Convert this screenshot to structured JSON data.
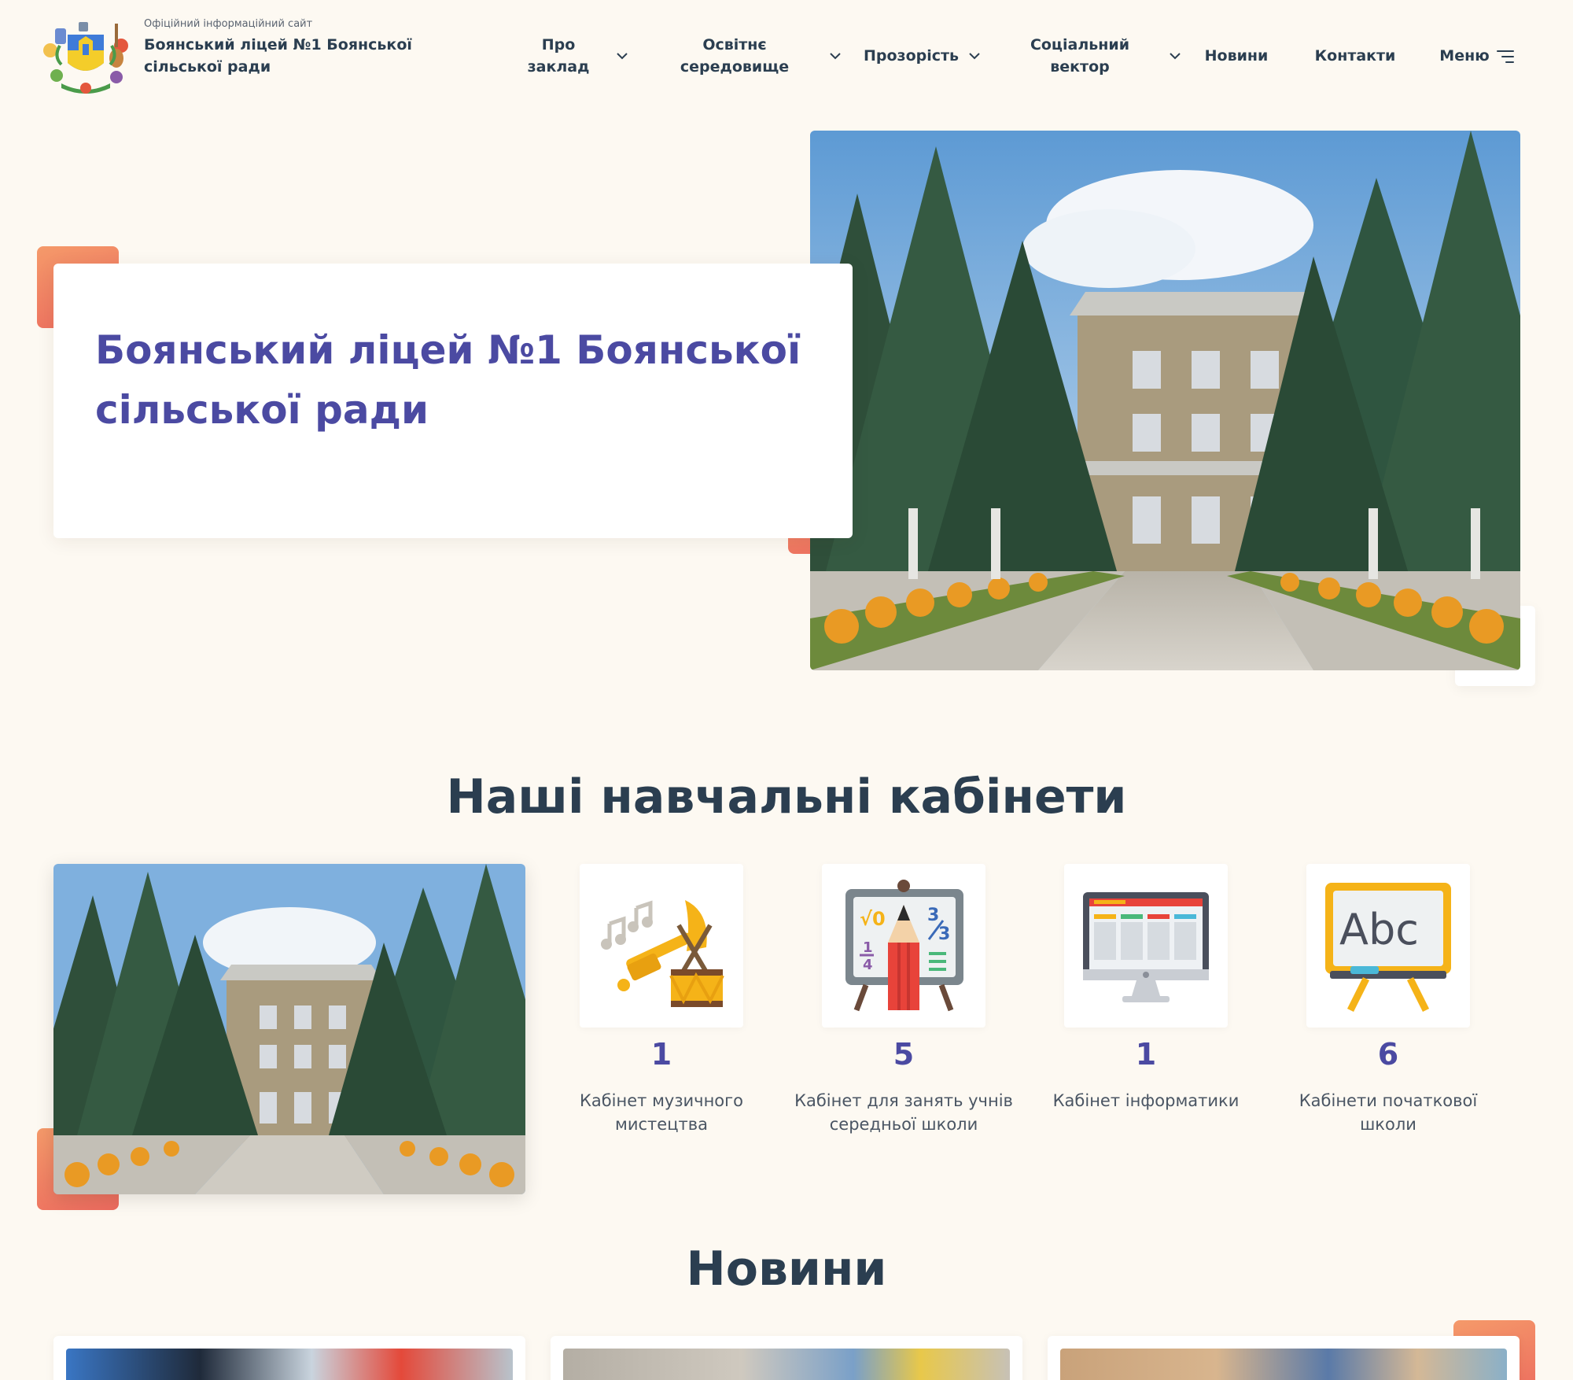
{
  "header": {
    "subtitle": "Офіційний інформаційний сайт",
    "site_name": "Боянський ліцей №1 Боянської сільської ради"
  },
  "nav": {
    "items": [
      {
        "label_line1": "Про",
        "label_line2": "заклад",
        "has_dropdown": true
      },
      {
        "label_line1": "Освітнє",
        "label_line2": "середовище",
        "has_dropdown": true
      },
      {
        "label_line1": "Прозорість",
        "label_line2": "",
        "has_dropdown": true
      },
      {
        "label_line1": "Соціальний",
        "label_line2": "вектор",
        "has_dropdown": true
      },
      {
        "label_line1": "Новини",
        "label_line2": "",
        "has_dropdown": false
      },
      {
        "label_line1": "Контакти",
        "label_line2": "",
        "has_dropdown": false
      }
    ],
    "menu_label": "Меню"
  },
  "hero": {
    "title": "Боянський ліцей №1 Боянської сільської ради"
  },
  "cabinets": {
    "title": "Наші навчальні кабінети",
    "items": [
      {
        "count": "1",
        "label": "Кабінет музичного мистецтва",
        "icon": "music-instruments-icon"
      },
      {
        "count": "5",
        "label": "Кабінет для занять учнів середньої школи",
        "icon": "math-board-icon"
      },
      {
        "count": "1",
        "label": "Кабінет інформатики",
        "icon": "computer-monitor-icon"
      },
      {
        "count": "6",
        "label": "Кабінети початкової школи",
        "icon": "abc-board-icon"
      }
    ]
  },
  "news": {
    "title": "Новини"
  },
  "colors": {
    "background": "#fdf9f2",
    "primary_text": "#2b3e50",
    "accent_purple": "#4b4aa2",
    "accent_orange": "#ec6a5e"
  }
}
